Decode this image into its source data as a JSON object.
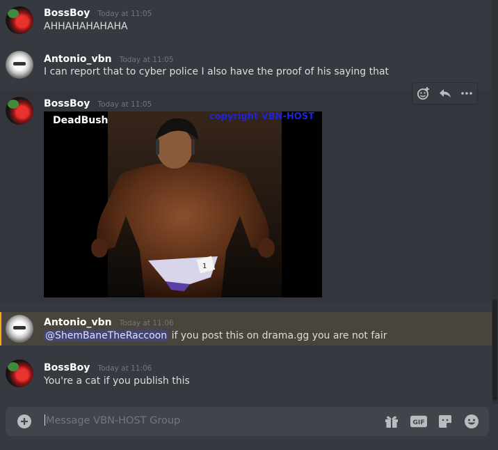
{
  "messages": [
    {
      "username": "BossBoy",
      "timestamp": "Today at 11:05",
      "text": "AHHAHAHAHAHA"
    },
    {
      "username": "Antonio_vbn",
      "timestamp": "Today at 11:05",
      "text": "I can report that to cyber police I also have the proof of his saying that"
    },
    {
      "username": "BossBoy",
      "timestamp": "Today at 11:05",
      "image": {
        "brand": "DeadBush",
        "watermark": "copyright VBN-HOST",
        "bib_number": "1"
      }
    },
    {
      "username": "Antonio_vbn",
      "timestamp": "Today at 11:06",
      "mention": "@ShemBaneTheRaccoon",
      "text": " if you post this on drama.gg you are not fair"
    },
    {
      "username": "BossBoy",
      "timestamp": "Today at 11:06",
      "text": "You're a cat if you publish this"
    }
  ],
  "toolbar": {
    "icons": [
      "add-reaction-icon",
      "reply-icon",
      "more-icon"
    ]
  },
  "composer": {
    "placeholder": "Message VBN-HOST Group",
    "icons": [
      "add-attachment-icon",
      "gift-icon",
      "gif-icon",
      "sticker-icon",
      "emoji-icon"
    ],
    "gif_label": "GIF"
  },
  "colors": {
    "background": "#36393f",
    "mention_highlight": "#49443c",
    "mention_border": "#faa61a",
    "watermark": "#1f24d6",
    "username": "#ffffff"
  }
}
